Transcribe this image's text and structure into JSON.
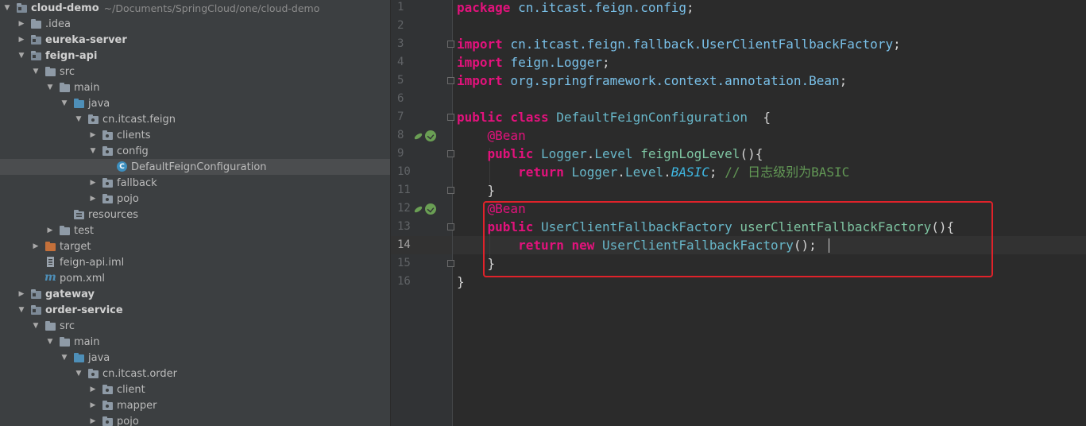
{
  "project_tree": {
    "items": [
      {
        "label": "cloud-demo",
        "path": "~/Documents/SpringCloud/one/cloud-demo",
        "bold": true,
        "depth": 0,
        "expanded": true,
        "icon": "module-folder-icon"
      },
      {
        "label": ".idea",
        "depth": 1,
        "expanded": false,
        "icon": "folder-icon"
      },
      {
        "label": "eureka-server",
        "bold": true,
        "depth": 1,
        "expanded": false,
        "icon": "module-folder-icon"
      },
      {
        "label": "feign-api",
        "bold": true,
        "depth": 1,
        "expanded": true,
        "icon": "module-folder-icon"
      },
      {
        "label": "src",
        "depth": 2,
        "expanded": true,
        "icon": "folder-icon"
      },
      {
        "label": "main",
        "depth": 3,
        "expanded": true,
        "icon": "folder-icon"
      },
      {
        "label": "java",
        "depth": 4,
        "expanded": true,
        "icon": "source-folder-icon"
      },
      {
        "label": "cn.itcast.feign",
        "depth": 5,
        "expanded": true,
        "icon": "package-icon"
      },
      {
        "label": "clients",
        "depth": 6,
        "expanded": false,
        "icon": "package-icon"
      },
      {
        "label": "config",
        "depth": 6,
        "expanded": true,
        "icon": "package-icon"
      },
      {
        "label": "DefaultFeignConfiguration",
        "depth": 7,
        "leaf": true,
        "selected": true,
        "icon": "class-icon"
      },
      {
        "label": "fallback",
        "depth": 6,
        "expanded": false,
        "icon": "package-icon"
      },
      {
        "label": "pojo",
        "depth": 6,
        "expanded": false,
        "icon": "package-icon"
      },
      {
        "label": "resources",
        "depth": 4,
        "leaf": true,
        "icon": "resources-folder-icon"
      },
      {
        "label": "test",
        "depth": 3,
        "expanded": false,
        "icon": "folder-icon"
      },
      {
        "label": "target",
        "depth": 2,
        "expanded": false,
        "icon": "target-folder-icon"
      },
      {
        "label": "feign-api.iml",
        "depth": 2,
        "leaf": true,
        "icon": "iml-file-icon"
      },
      {
        "label": "pom.xml",
        "depth": 2,
        "leaf": true,
        "icon": "maven-icon"
      },
      {
        "label": "gateway",
        "bold": true,
        "depth": 1,
        "expanded": false,
        "icon": "module-folder-icon"
      },
      {
        "label": "order-service",
        "bold": true,
        "depth": 1,
        "expanded": true,
        "icon": "module-folder-icon"
      },
      {
        "label": "src",
        "depth": 2,
        "expanded": true,
        "icon": "folder-icon"
      },
      {
        "label": "main",
        "depth": 3,
        "expanded": true,
        "icon": "folder-icon"
      },
      {
        "label": "java",
        "depth": 4,
        "expanded": true,
        "icon": "source-folder-icon"
      },
      {
        "label": "cn.itcast.order",
        "depth": 5,
        "expanded": true,
        "icon": "package-icon"
      },
      {
        "label": "client",
        "depth": 6,
        "expanded": false,
        "icon": "package-icon"
      },
      {
        "label": "mapper",
        "depth": 6,
        "expanded": false,
        "icon": "package-icon"
      },
      {
        "label": "pojo",
        "depth": 6,
        "expanded": false,
        "icon": "package-icon"
      }
    ]
  },
  "editor": {
    "current_line": 14,
    "line_numbers": [
      "1",
      "2",
      "3",
      "4",
      "5",
      "6",
      "7",
      "8",
      "9",
      "10",
      "11",
      "12",
      "13",
      "14",
      "15",
      "16"
    ],
    "lines": [
      [
        {
          "t": "package",
          "c": "kw"
        },
        {
          "t": " cn.itcast.feign.config",
          "c": "pkg"
        },
        {
          "t": ";",
          "c": "plain"
        }
      ],
      [],
      [
        {
          "t": "import",
          "c": "kw"
        },
        {
          "t": " cn.itcast.feign.fallback.UserClientFallbackFactory",
          "c": "pkg"
        },
        {
          "t": ";",
          "c": "plain"
        }
      ],
      [
        {
          "t": "import",
          "c": "kw"
        },
        {
          "t": " feign.Logger",
          "c": "pkg"
        },
        {
          "t": ";",
          "c": "plain"
        }
      ],
      [
        {
          "t": "import",
          "c": "kw"
        },
        {
          "t": " org.springframework.context.annotation.Bean",
          "c": "pkg"
        },
        {
          "t": ";",
          "c": "plain"
        }
      ],
      [],
      [
        {
          "t": "public class ",
          "c": "kw"
        },
        {
          "t": "DefaultFeignConfiguration",
          "c": "cls"
        },
        {
          "t": "  {",
          "c": "plain"
        }
      ],
      [
        {
          "t": "    ",
          "c": "plain"
        },
        {
          "t": "@Bean",
          "c": "ann"
        }
      ],
      [
        {
          "t": "    ",
          "c": "plain"
        },
        {
          "t": "public ",
          "c": "kw"
        },
        {
          "t": "Logger",
          "c": "cls"
        },
        {
          "t": ".",
          "c": "plain"
        },
        {
          "t": "Level ",
          "c": "cls"
        },
        {
          "t": "feignLogLevel",
          "c": "method"
        },
        {
          "t": "(){",
          "c": "plain"
        }
      ],
      [
        {
          "t": "        ",
          "c": "plain"
        },
        {
          "t": "return ",
          "c": "kw"
        },
        {
          "t": "Logger",
          "c": "cls"
        },
        {
          "t": ".",
          "c": "plain"
        },
        {
          "t": "Level",
          "c": "cls"
        },
        {
          "t": ".",
          "c": "plain"
        },
        {
          "t": "BASIC",
          "c": "static-italic"
        },
        {
          "t": "; ",
          "c": "plain"
        },
        {
          "t": "// 日志级别为BASIC",
          "c": "cmt"
        }
      ],
      [
        {
          "t": "    }",
          "c": "plain"
        }
      ],
      [
        {
          "t": "    ",
          "c": "plain"
        },
        {
          "t": "@Bean",
          "c": "ann"
        }
      ],
      [
        {
          "t": "    ",
          "c": "plain"
        },
        {
          "t": "public ",
          "c": "kw"
        },
        {
          "t": "UserClientFallbackFactory ",
          "c": "cls"
        },
        {
          "t": "userClientFallbackFactory",
          "c": "method"
        },
        {
          "t": "(){",
          "c": "plain"
        }
      ],
      [
        {
          "t": "        ",
          "c": "plain"
        },
        {
          "t": "return new ",
          "c": "kw"
        },
        {
          "t": "UserClientFallbackFactory",
          "c": "cls"
        },
        {
          "t": "();",
          "c": "plain"
        }
      ],
      [
        {
          "t": "    }",
          "c": "plain"
        }
      ],
      [
        {
          "t": "}",
          "c": "plain"
        }
      ]
    ],
    "colors": {
      "keyword": "#e3127c",
      "annotation": "#e3127c",
      "class": "#68b7c9",
      "method": "#7fc6a3",
      "comment": "#629755",
      "highlight_box": "#e0222a"
    }
  }
}
